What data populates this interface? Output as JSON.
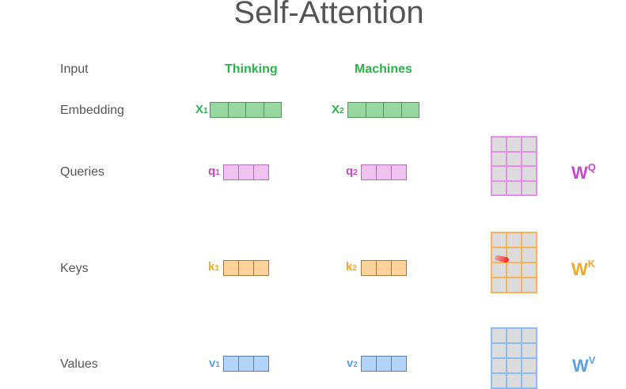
{
  "title": "Self-Attention",
  "rows": {
    "input": "Input",
    "embedding": "Embedding",
    "queries": "Queries",
    "keys": "Keys",
    "values": "Values"
  },
  "words": [
    "Thinking",
    "Machines"
  ],
  "embedding_vectors": [
    {
      "label": "X",
      "sub": "1",
      "cells": 4
    },
    {
      "label": "X",
      "sub": "2",
      "cells": 4
    }
  ],
  "query_vectors": [
    {
      "label": "q",
      "sub": "1",
      "cells": 3
    },
    {
      "label": "q",
      "sub": "2",
      "cells": 3
    }
  ],
  "key_vectors": [
    {
      "label": "k",
      "sub": "1",
      "cells": 3
    },
    {
      "label": "k",
      "sub": "2",
      "cells": 3
    }
  ],
  "value_vectors": [
    {
      "label": "v",
      "sub": "1",
      "cells": 3
    },
    {
      "label": "v",
      "sub": "2",
      "cells": 3
    }
  ],
  "weights": {
    "query": {
      "label": "W",
      "sup": "Q"
    },
    "key": {
      "label": "W",
      "sup": "K"
    },
    "value": {
      "label": "W",
      "sup": "V"
    }
  },
  "colors": {
    "green_text": "#2ab24b",
    "embedding_fill": "#98d8a0",
    "embedding_border": "#4a9a5a",
    "query_text": "#cc44cc",
    "query_fill": "#f0c2f0",
    "query_border": "#b070b0",
    "query_matrix": "#e58ee5",
    "key_text": "#f5a623",
    "key_fill": "#fdd39a",
    "key_border": "#a07840",
    "key_matrix": "#f8b35a",
    "value_text": "#5aa0e8",
    "value_fill": "#b3d4f8",
    "value_border": "#5a7fa8",
    "value_matrix": "#8fbcf0"
  }
}
